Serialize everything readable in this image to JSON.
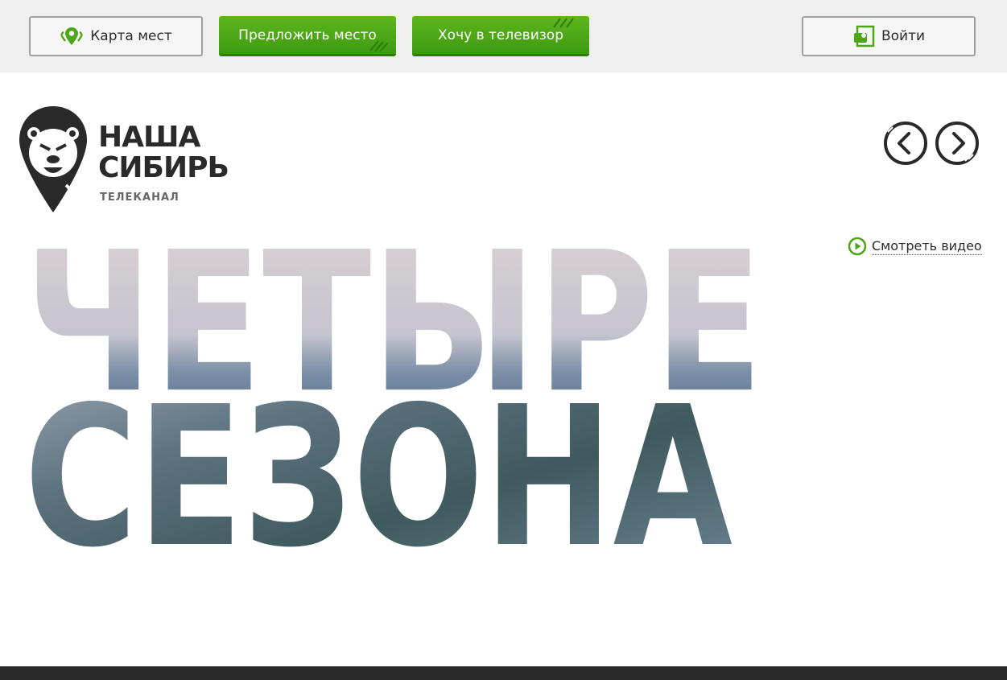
{
  "header": {
    "map_label": "Карта мест",
    "suggest_label": "Предложить место",
    "tv_label": "Хочу в телевизор",
    "login_label": "Войти"
  },
  "brand": {
    "name_line1": "НАША",
    "name_line2": "СИБИРЬ",
    "tagline": "ТЕЛЕКАНАЛ",
    "icon": "bear-logo-icon"
  },
  "slider": {
    "prev_icon": "chevron-left-icon",
    "next_icon": "chevron-right-icon"
  },
  "hero": {
    "title_line1": "ЧЕТЫРЕ",
    "title_line2": "СЕЗОНА",
    "watch_label": "Смотреть видео"
  },
  "colors": {
    "accent": "#4ea515",
    "dark": "#2a2a2a",
    "topbar": "#efefef"
  }
}
